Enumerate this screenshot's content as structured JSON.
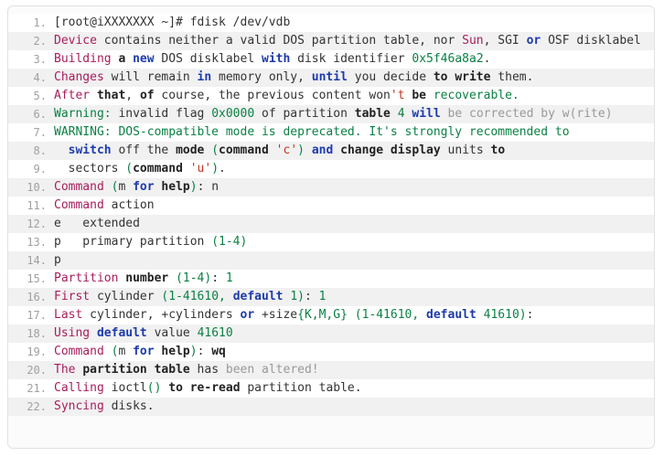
{
  "card": {
    "name": "fdisk-terminal-transcript",
    "background": "#fbfbfb",
    "border_color": "#e2e2e2"
  },
  "colors": {
    "line_number": "#a0a0a0",
    "plain": "#333333",
    "keyword_purple": "#a71d5d",
    "bold_dark": "#222222",
    "keyword_blue": "#1d3bad",
    "literal_green": "#0a8043",
    "comment_gray": "#999999",
    "string_red": "#c0341d",
    "row_alt_background": "#f1f1f1",
    "row_background": "#ffffff"
  },
  "lines": [
    {
      "number": "1.",
      "text": "[root@iXXXXXXX ~]# fdisk /dev/vdb",
      "tokens": [
        {
          "t": "[root@iXXXXXXX ~]# fdisk /dev/vdb",
          "c": "t-plain"
        }
      ]
    },
    {
      "number": "2.",
      "text": "Device contains neither a valid DOS partition table, nor Sun, SGI or OSF disklabel",
      "tokens": [
        {
          "t": "Device",
          "c": "t-kw"
        },
        {
          "t": " contains neither a valid DOS partition table, nor ",
          "c": "t-plain"
        },
        {
          "t": "Sun",
          "c": "t-kw"
        },
        {
          "t": ", SGI ",
          "c": "t-plain"
        },
        {
          "t": "or",
          "c": "t-blue"
        },
        {
          "t": " OSF disklabel",
          "c": "t-plain"
        }
      ]
    },
    {
      "number": "3.",
      "text": "Building a new DOS disklabel with disk identifier 0x5f46a8a2.",
      "tokens": [
        {
          "t": "Building",
          "c": "t-kw"
        },
        {
          "t": " ",
          "c": "t-plain"
        },
        {
          "t": "a",
          "c": "t-bold"
        },
        {
          "t": " ",
          "c": "t-plain"
        },
        {
          "t": "new",
          "c": "t-blue"
        },
        {
          "t": " DOS disklabel ",
          "c": "t-plain"
        },
        {
          "t": "with",
          "c": "t-blue"
        },
        {
          "t": " disk identifier ",
          "c": "t-plain"
        },
        {
          "t": "0x5f46a8a2",
          "c": "t-green"
        },
        {
          "t": ".",
          "c": "t-plain"
        }
      ]
    },
    {
      "number": "4.",
      "text": "Changes will remain in memory only, until you decide to write them.",
      "tokens": [
        {
          "t": "Changes",
          "c": "t-kw"
        },
        {
          "t": " will remain ",
          "c": "t-plain"
        },
        {
          "t": "in",
          "c": "t-blue"
        },
        {
          "t": " memory only, ",
          "c": "t-plain"
        },
        {
          "t": "until",
          "c": "t-blue"
        },
        {
          "t": " you decide ",
          "c": "t-plain"
        },
        {
          "t": "to",
          "c": "t-bold"
        },
        {
          "t": " ",
          "c": "t-plain"
        },
        {
          "t": "write",
          "c": "t-bold"
        },
        {
          "t": " them.",
          "c": "t-plain"
        }
      ]
    },
    {
      "number": "5.",
      "text": "After that, of course, the previous content won't be recoverable.",
      "tokens": [
        {
          "t": "After",
          "c": "t-kw"
        },
        {
          "t": " ",
          "c": "t-plain"
        },
        {
          "t": "that",
          "c": "t-bold"
        },
        {
          "t": ", ",
          "c": "t-plain"
        },
        {
          "t": "of",
          "c": "t-bold"
        },
        {
          "t": " course, the previous content won",
          "c": "t-plain"
        },
        {
          "t": "'t ",
          "c": "t-red"
        },
        {
          "t": "be",
          "c": "t-bold"
        },
        {
          "t": " recoverable.",
          "c": "t-green"
        }
      ]
    },
    {
      "number": "6.",
      "text": "Warning: invalid flag 0x0000 of partition table 4 will be corrected by w(rite)",
      "tokens": [
        {
          "t": "Warning:",
          "c": "t-green"
        },
        {
          "t": " invalid flag ",
          "c": "t-plain"
        },
        {
          "t": "0x0000",
          "c": "t-green"
        },
        {
          "t": " of partition ",
          "c": "t-plain"
        },
        {
          "t": "table",
          "c": "t-bold"
        },
        {
          "t": " ",
          "c": "t-plain"
        },
        {
          "t": "4",
          "c": "t-green"
        },
        {
          "t": " ",
          "c": "t-plain"
        },
        {
          "t": "will",
          "c": "t-blue"
        },
        {
          "t": " be corrected by w(rite)",
          "c": "t-gray"
        }
      ]
    },
    {
      "number": "7.",
      "text": "WARNING: DOS-compatible mode is deprecated. It's strongly recommended to",
      "tokens": [
        {
          "t": "WARNING: DOS-compatible mode is deprecated. It's strongly recommended to",
          "c": "t-green"
        }
      ]
    },
    {
      "number": "8.",
      "text": "  switch off the mode (command 'c') and change display units to",
      "tokens": [
        {
          "t": "  ",
          "c": "t-plain"
        },
        {
          "t": "switch",
          "c": "t-blue"
        },
        {
          "t": " off the ",
          "c": "t-plain"
        },
        {
          "t": "mode",
          "c": "t-bold"
        },
        {
          "t": " ",
          "c": "t-plain"
        },
        {
          "t": "(",
          "c": "t-green"
        },
        {
          "t": "command",
          "c": "t-bold"
        },
        {
          "t": " ",
          "c": "t-plain"
        },
        {
          "t": "'c'",
          "c": "t-red"
        },
        {
          "t": ")",
          "c": "t-green"
        },
        {
          "t": " ",
          "c": "t-plain"
        },
        {
          "t": "and",
          "c": "t-blue"
        },
        {
          "t": " ",
          "c": "t-plain"
        },
        {
          "t": "change",
          "c": "t-bold"
        },
        {
          "t": " ",
          "c": "t-plain"
        },
        {
          "t": "display",
          "c": "t-bold"
        },
        {
          "t": " units ",
          "c": "t-plain"
        },
        {
          "t": "to",
          "c": "t-bold"
        }
      ]
    },
    {
      "number": "9.",
      "text": "  sectors (command 'u').",
      "tokens": [
        {
          "t": "  sectors ",
          "c": "t-plain"
        },
        {
          "t": "(",
          "c": "t-green"
        },
        {
          "t": "command",
          "c": "t-bold"
        },
        {
          "t": " ",
          "c": "t-plain"
        },
        {
          "t": "'u'",
          "c": "t-red"
        },
        {
          "t": ")",
          "c": "t-green"
        },
        {
          "t": ".",
          "c": "t-plain"
        }
      ]
    },
    {
      "number": "10.",
      "text": "Command (m for help): n",
      "tokens": [
        {
          "t": "Command",
          "c": "t-kw"
        },
        {
          "t": " ",
          "c": "t-plain"
        },
        {
          "t": "(",
          "c": "t-green"
        },
        {
          "t": "m",
          "c": "t-plain"
        },
        {
          "t": " ",
          "c": "t-plain"
        },
        {
          "t": "for",
          "c": "t-blue"
        },
        {
          "t": " ",
          "c": "t-plain"
        },
        {
          "t": "help",
          "c": "t-bold"
        },
        {
          "t": ")",
          "c": "t-green"
        },
        {
          "t": ": n",
          "c": "t-plain"
        }
      ]
    },
    {
      "number": "11.",
      "text": "Command action",
      "tokens": [
        {
          "t": "Command",
          "c": "t-kw"
        },
        {
          "t": " action",
          "c": "t-plain"
        }
      ]
    },
    {
      "number": "12.",
      "text": "e   extended",
      "tokens": [
        {
          "t": "e   extended",
          "c": "t-plain"
        }
      ]
    },
    {
      "number": "13.",
      "text": "p   primary partition (1-4)",
      "tokens": [
        {
          "t": "p   primary partition ",
          "c": "t-plain"
        },
        {
          "t": "(1-4)",
          "c": "t-green"
        }
      ]
    },
    {
      "number": "14.",
      "text": "p",
      "tokens": [
        {
          "t": "p",
          "c": "t-plain"
        }
      ]
    },
    {
      "number": "15.",
      "text": "Partition number (1-4): 1",
      "tokens": [
        {
          "t": "Partition",
          "c": "t-kw"
        },
        {
          "t": " ",
          "c": "t-plain"
        },
        {
          "t": "number",
          "c": "t-bold"
        },
        {
          "t": " ",
          "c": "t-plain"
        },
        {
          "t": "(1-4)",
          "c": "t-green"
        },
        {
          "t": ": ",
          "c": "t-plain"
        },
        {
          "t": "1",
          "c": "t-green"
        }
      ]
    },
    {
      "number": "16.",
      "text": "First cylinder (1-41610, default 1): 1",
      "tokens": [
        {
          "t": "First",
          "c": "t-kw"
        },
        {
          "t": " cylinder ",
          "c": "t-plain"
        },
        {
          "t": "(1-41610,",
          "c": "t-green"
        },
        {
          "t": " ",
          "c": "t-plain"
        },
        {
          "t": "default",
          "c": "t-blue"
        },
        {
          "t": " ",
          "c": "t-plain"
        },
        {
          "t": "1)",
          "c": "t-green"
        },
        {
          "t": ": ",
          "c": "t-plain"
        },
        {
          "t": "1",
          "c": "t-green"
        }
      ]
    },
    {
      "number": "17.",
      "text": "Last cylinder, +cylinders or +size{K,M,G} (1-41610, default 41610):",
      "tokens": [
        {
          "t": "Last",
          "c": "t-kw"
        },
        {
          "t": " cylinder, +cylinders ",
          "c": "t-plain"
        },
        {
          "t": "or",
          "c": "t-blue"
        },
        {
          "t": " +size",
          "c": "t-plain"
        },
        {
          "t": "{K,M,G}",
          "c": "t-green"
        },
        {
          "t": " ",
          "c": "t-plain"
        },
        {
          "t": "(1-41610,",
          "c": "t-green"
        },
        {
          "t": " ",
          "c": "t-plain"
        },
        {
          "t": "default",
          "c": "t-blue"
        },
        {
          "t": " ",
          "c": "t-plain"
        },
        {
          "t": "41610)",
          "c": "t-green"
        },
        {
          "t": ":",
          "c": "t-plain"
        }
      ]
    },
    {
      "number": "18.",
      "text": "Using default value 41610",
      "tokens": [
        {
          "t": "Using",
          "c": "t-kw"
        },
        {
          "t": " ",
          "c": "t-plain"
        },
        {
          "t": "default",
          "c": "t-blue"
        },
        {
          "t": " value ",
          "c": "t-plain"
        },
        {
          "t": "41610",
          "c": "t-green"
        }
      ]
    },
    {
      "number": "19.",
      "text": "Command (m for help): wq",
      "tokens": [
        {
          "t": "Command",
          "c": "t-kw"
        },
        {
          "t": " ",
          "c": "t-plain"
        },
        {
          "t": "(",
          "c": "t-green"
        },
        {
          "t": "m",
          "c": "t-plain"
        },
        {
          "t": " ",
          "c": "t-plain"
        },
        {
          "t": "for",
          "c": "t-blue"
        },
        {
          "t": " ",
          "c": "t-plain"
        },
        {
          "t": "help",
          "c": "t-bold"
        },
        {
          "t": ")",
          "c": "t-green"
        },
        {
          "t": ": ",
          "c": "t-plain"
        },
        {
          "t": "wq",
          "c": "t-bold"
        }
      ]
    },
    {
      "number": "20.",
      "text": "The partition table has been altered!",
      "tokens": [
        {
          "t": "The",
          "c": "t-kw"
        },
        {
          "t": " ",
          "c": "t-plain"
        },
        {
          "t": "partition",
          "c": "t-bold"
        },
        {
          "t": " ",
          "c": "t-plain"
        },
        {
          "t": "table",
          "c": "t-bold"
        },
        {
          "t": " has",
          "c": "t-plain"
        },
        {
          "t": " been altered!",
          "c": "t-gray"
        }
      ]
    },
    {
      "number": "21.",
      "text": "Calling ioctl() to re-read partition table.",
      "tokens": [
        {
          "t": "Calling",
          "c": "t-kw"
        },
        {
          "t": " ioctl",
          "c": "t-plain"
        },
        {
          "t": "()",
          "c": "t-green"
        },
        {
          "t": " ",
          "c": "t-plain"
        },
        {
          "t": "to",
          "c": "t-bold"
        },
        {
          "t": " ",
          "c": "t-plain"
        },
        {
          "t": "re-read",
          "c": "t-bold"
        },
        {
          "t": " partition table.",
          "c": "t-plain"
        }
      ]
    },
    {
      "number": "22.",
      "text": "Syncing disks.",
      "tokens": [
        {
          "t": "Syncing",
          "c": "t-kw"
        },
        {
          "t": " disks.",
          "c": "t-plain"
        }
      ]
    }
  ]
}
